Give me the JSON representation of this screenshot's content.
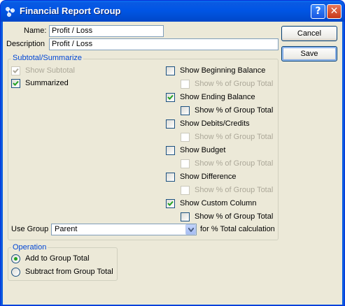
{
  "window": {
    "title": "Financial Report Group",
    "help_label": "?",
    "close_label": "✕"
  },
  "form": {
    "name_label": "Name:",
    "name_value": "Profit / Loss",
    "description_label": "Description",
    "description_value": "Profit / Loss"
  },
  "buttons": {
    "cancel": "Cancel",
    "save": "Save"
  },
  "subtotal": {
    "legend": "Subtotal/Summarize",
    "show_subtotal": {
      "label": "Show Subtotal",
      "checked": true,
      "enabled": false
    },
    "summarized": {
      "label": "Summarized",
      "checked": true,
      "enabled": true
    },
    "options": [
      {
        "label": "Show Beginning Balance",
        "checked": false,
        "pct_label": "Show % of Group Total",
        "pct_checked": false,
        "pct_enabled": false
      },
      {
        "label": "Show Ending Balance",
        "checked": true,
        "pct_label": "Show % of Group Total",
        "pct_checked": false,
        "pct_enabled": true
      },
      {
        "label": "Show Debits/Credits",
        "checked": false,
        "pct_label": "Show % of Group Total",
        "pct_checked": false,
        "pct_enabled": false
      },
      {
        "label": "Show Budget",
        "checked": false,
        "pct_label": "Show % of Group Total",
        "pct_checked": false,
        "pct_enabled": false
      },
      {
        "label": "Show Difference",
        "checked": false,
        "pct_label": "Show % of Group Total",
        "pct_checked": false,
        "pct_enabled": false
      },
      {
        "label": "Show Custom Column",
        "checked": true,
        "pct_label": "Show % of Group Total",
        "pct_checked": false,
        "pct_enabled": true
      }
    ],
    "use_group_label": "Use Group",
    "use_group_value": "Parent",
    "calc_suffix": "for % Total calculation"
  },
  "operation": {
    "legend": "Operation",
    "options": [
      {
        "label": "Add to Group Total",
        "selected": true
      },
      {
        "label": "Subtract from Group Total",
        "selected": false
      }
    ]
  },
  "colors": {
    "title_bar": "#0055e5",
    "dialog_bg": "#ece9d8",
    "legend_text": "#0046d5",
    "checkmark": "#21a121"
  }
}
